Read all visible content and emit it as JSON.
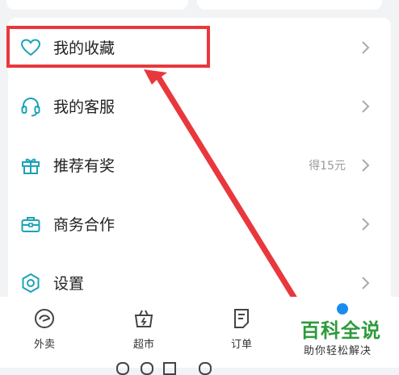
{
  "menu": {
    "items": [
      {
        "label": "我的收藏",
        "icon": "heart-icon",
        "extra": ""
      },
      {
        "label": "我的客服",
        "icon": "headset-icon",
        "extra": ""
      },
      {
        "label": "推荐有奖",
        "icon": "gift-icon",
        "extra": "得15元"
      },
      {
        "label": "商务合作",
        "icon": "briefcase-icon",
        "extra": ""
      },
      {
        "label": "设置",
        "icon": "settings-icon",
        "extra": ""
      }
    ]
  },
  "tabbar": {
    "tabs": [
      {
        "label": "外卖",
        "icon": "waimai-icon"
      },
      {
        "label": "超市",
        "icon": "basket-icon"
      },
      {
        "label": "订单",
        "icon": "order-icon"
      },
      {
        "label": "",
        "icon": "profile-icon"
      }
    ]
  },
  "watermark": {
    "title": "百科全说",
    "subtitle": "助你轻松解决"
  },
  "colors": {
    "accent": "#1aa3b8",
    "highlight": "#e8383d",
    "tab_dot": "#1a8cf0",
    "watermark_green": "#2e9a3c"
  }
}
